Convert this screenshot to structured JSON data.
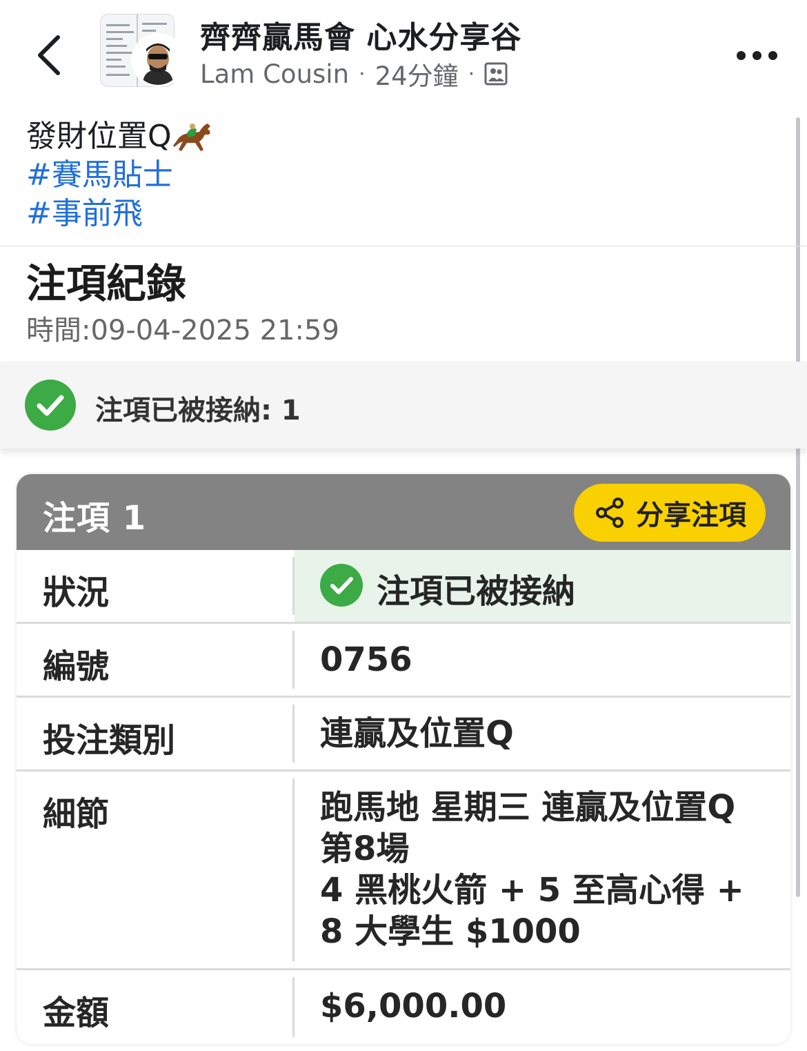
{
  "header": {
    "group_name": "齊齊贏馬會 心水分享谷",
    "author": "Lam Cousin",
    "time_ago": "24分鐘",
    "audience_icon": "group-audience-icon",
    "back_icon": "chevron-left-icon",
    "more_icon": "more-dots-icon"
  },
  "post": {
    "caption": "發財位置Q",
    "caption_emoji": "horse-racing-emoji",
    "hashtags": [
      "#賽馬貼士",
      "#事前飛"
    ]
  },
  "record": {
    "title": "注項紀錄",
    "time": "時間:09-04-2025 21:59",
    "accepted_summary": "注項已被接納: 1"
  },
  "bet": {
    "title": "注項 1",
    "share_label": "分享注項",
    "share_icon": "share-icon",
    "status_label": "狀況",
    "status_value": "注項已被接納",
    "id_label": "編號",
    "id_value": "0756",
    "type_label": "投注類別",
    "type_value": "連贏及位置Q",
    "detail_label": "細節",
    "detail_lines": [
      "跑馬地 星期三 連贏及位置Q",
      "第8場",
      "4 黑桃火箭 + 5 至高心得 +",
      "8 大學生 $1000"
    ],
    "amount_label": "金額",
    "amount_value": "$6,000.00"
  },
  "colors": {
    "accept_green": "#3caa45",
    "status_bg": "#e8f4e9",
    "card_header": "#838383",
    "share_yellow": "#f9d100",
    "hashtag_blue": "#216fdb"
  }
}
